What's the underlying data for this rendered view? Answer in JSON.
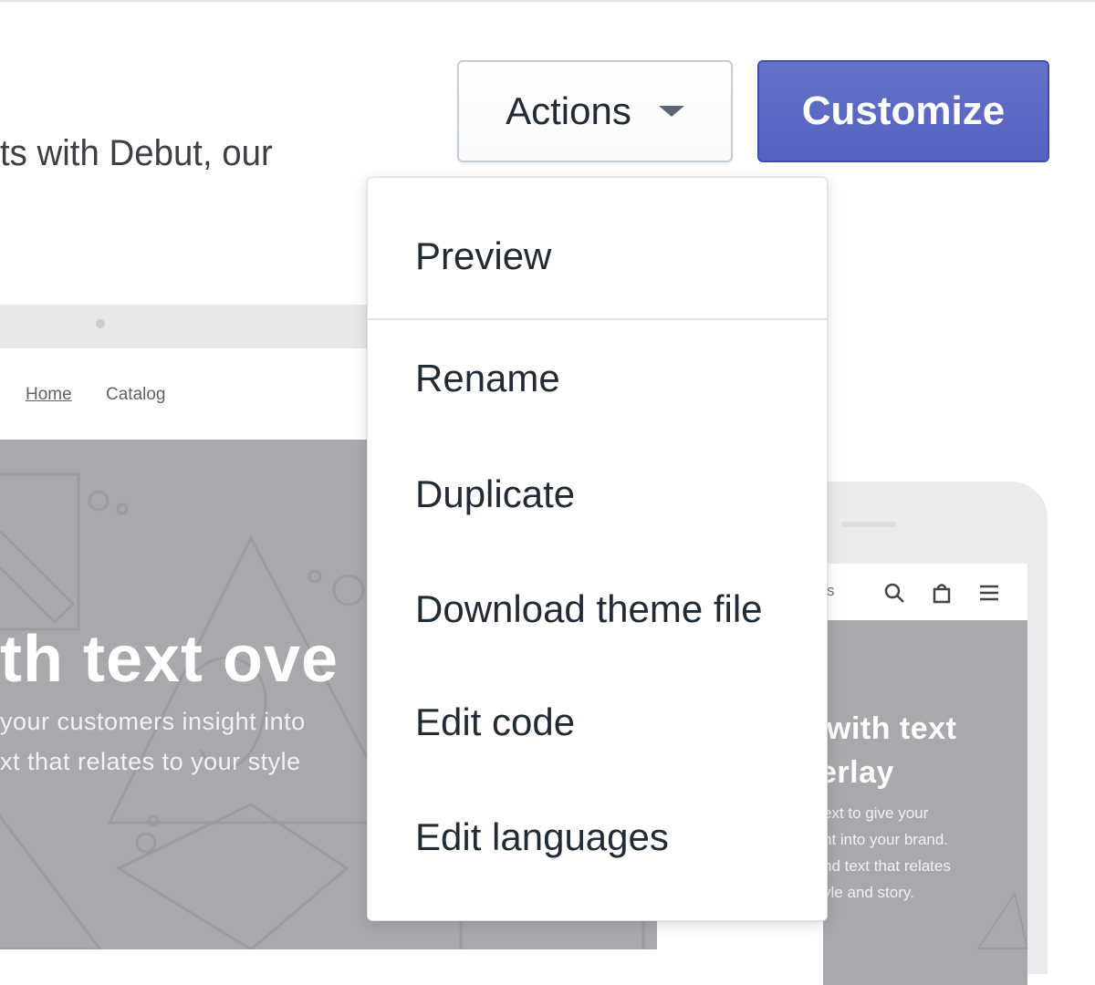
{
  "header": {
    "description_partial": "ts with Debut, our"
  },
  "buttons": {
    "actions_label": "Actions",
    "customize_label": "Customize"
  },
  "desktop_preview": {
    "nav": [
      "Home",
      "Catalog"
    ],
    "hero_title": "th text ove",
    "hero_lines": [
      "your customers insight into",
      "xt that relates to your style"
    ]
  },
  "mobile_preview": {
    "header_text": "s",
    "title_lines": [
      "with text",
      "erlay"
    ],
    "text_lines": [
      "ext to give your",
      "ht into your brand.",
      "nd text that relates",
      "yle and story."
    ]
  },
  "actions_menu": {
    "primary": [
      "Preview"
    ],
    "secondary": [
      "Rename",
      "Duplicate",
      "Download theme file",
      "Edit code",
      "Edit languages"
    ]
  },
  "colors": {
    "primary": "#5c6ac4",
    "text": "#212b36",
    "border": "#c4cdd5",
    "placeholder": "#a7a9ad"
  }
}
